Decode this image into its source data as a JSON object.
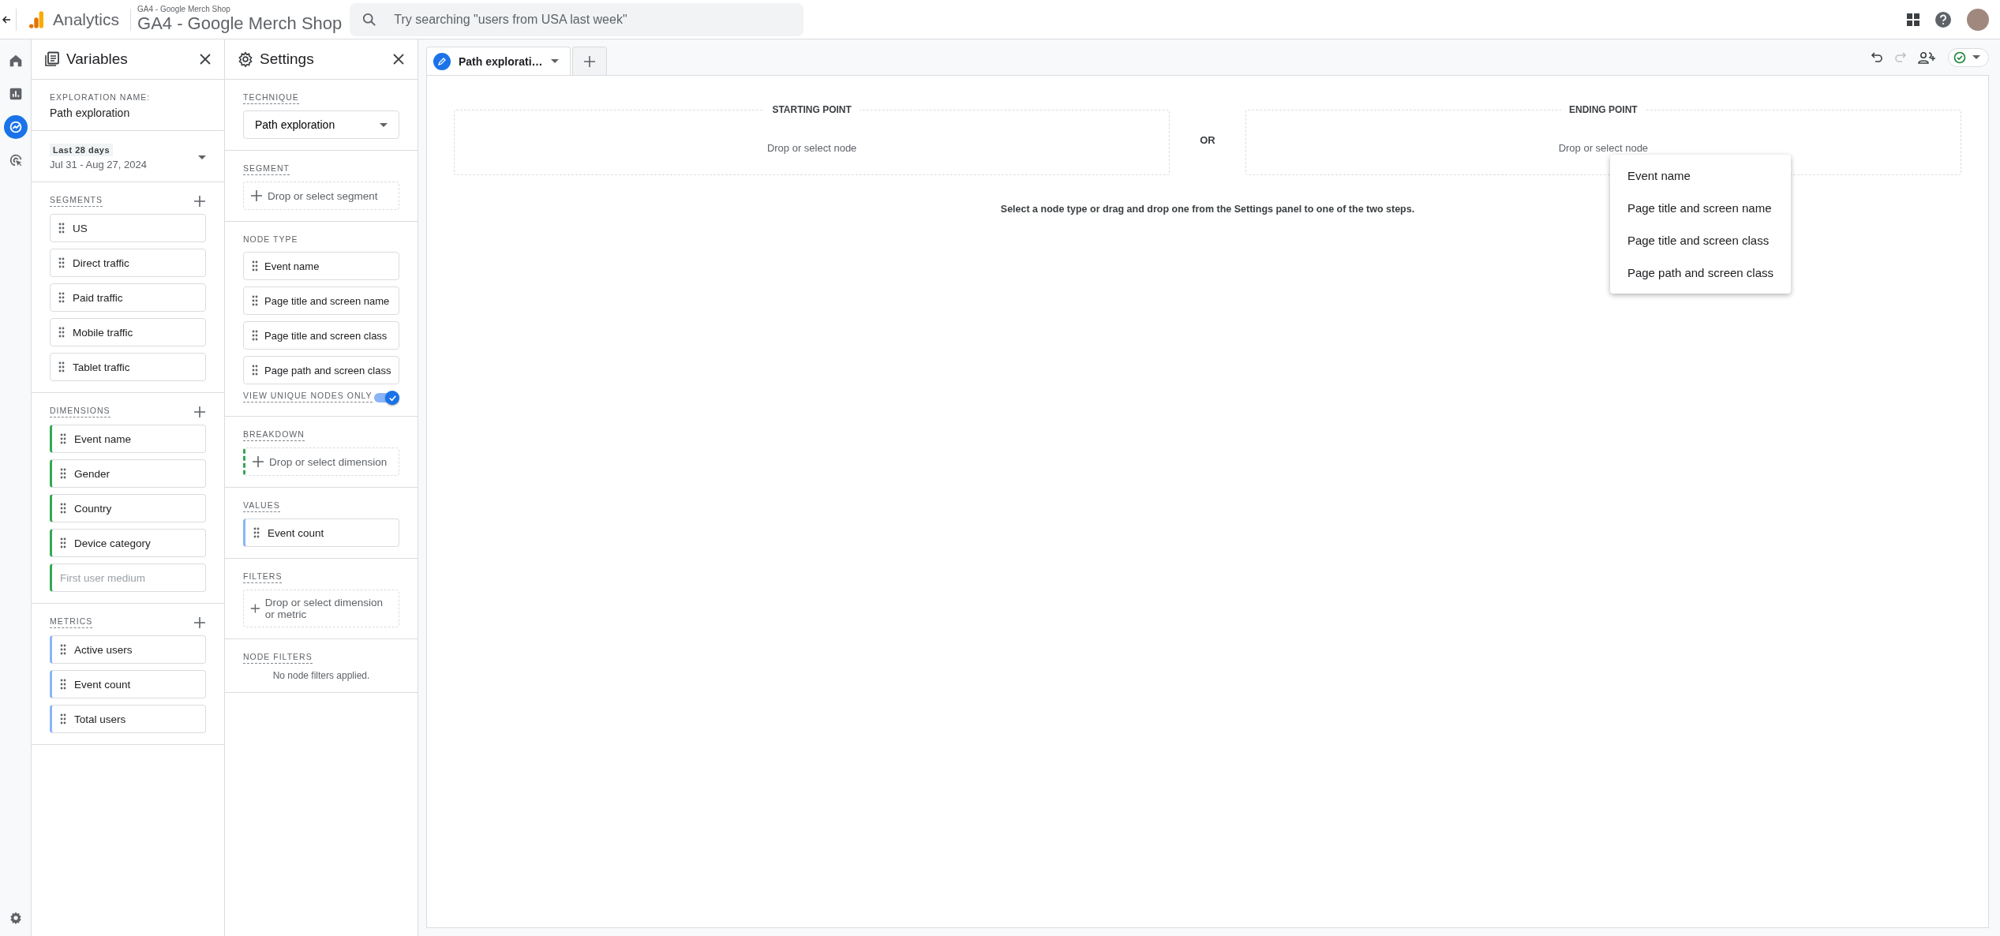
{
  "header": {
    "product": "Analytics",
    "account": "GA4 - Google Merch Shop",
    "property": "GA4 - Google Merch Shop",
    "search": {
      "placeholder": "Try searching \"users from USA last week\""
    }
  },
  "nav": [
    {
      "kind": "home",
      "selected": false
    },
    {
      "kind": "reports",
      "selected": false
    },
    {
      "kind": "explore",
      "selected": true
    },
    {
      "kind": "advertising",
      "selected": false
    }
  ],
  "variables": {
    "title": "Variables",
    "exploration_name_label": "EXPLORATION NAME:",
    "exploration_name": "Path exploration",
    "date_badge": "Last 28 days",
    "date_range": "Jul 31 - Aug 27, 2024",
    "segments": {
      "label": "SEGMENTS",
      "items": [
        {
          "name": "US",
          "disabled": false
        },
        {
          "name": "Direct traffic",
          "disabled": false
        },
        {
          "name": "Paid traffic",
          "disabled": false
        },
        {
          "name": "Mobile traffic",
          "disabled": false
        },
        {
          "name": "Tablet traffic",
          "disabled": false
        }
      ]
    },
    "dimensions": {
      "label": "DIMENSIONS",
      "items": [
        {
          "name": "Event name",
          "disabled": false
        },
        {
          "name": "Gender",
          "disabled": false
        },
        {
          "name": "Country",
          "disabled": false
        },
        {
          "name": "Device category",
          "disabled": false
        },
        {
          "name": "First user medium",
          "disabled": true
        }
      ]
    },
    "metrics": {
      "label": "METRICS",
      "items": [
        {
          "name": "Active users",
          "disabled": false
        },
        {
          "name": "Event count",
          "disabled": false
        },
        {
          "name": "Total users",
          "disabled": false
        }
      ]
    }
  },
  "settings": {
    "title": "Settings",
    "technique": {
      "label": "TECHNIQUE",
      "value": "Path exploration"
    },
    "segment": {
      "label": "SEGMENT",
      "prompt": "Drop or select segment"
    },
    "node_type": {
      "label": "NODE TYPE",
      "items": [
        "Event name",
        "Page title and screen name",
        "Page title and screen class",
        "Page path and screen class"
      ]
    },
    "unique_nodes": {
      "label": "VIEW UNIQUE NODES ONLY",
      "on": true
    },
    "breakdown": {
      "label": "BREAKDOWN",
      "prompt": "Drop or select dimension"
    },
    "values": {
      "label": "VALUES",
      "items": [
        "Event count"
      ]
    },
    "filters": {
      "label": "FILTERS",
      "prompt": "Drop or select dimension or metric"
    },
    "node_filters": {
      "label": "NODE FILTERS",
      "empty": "No node filters applied."
    }
  },
  "tabs": [
    {
      "label": "Path explorati…",
      "selected": true
    }
  ],
  "canvas": {
    "starting": {
      "title": "STARTING POINT",
      "prompt": "Drop or select node"
    },
    "or": "OR",
    "ending": {
      "title": "ENDING POINT",
      "prompt": "Drop or select node"
    },
    "hint": "Select a node type or drag and drop one from the Settings panel to one of the two steps.",
    "menu": [
      "Event name",
      "Page title and screen name",
      "Page title and screen class",
      "Page path and screen class"
    ]
  }
}
